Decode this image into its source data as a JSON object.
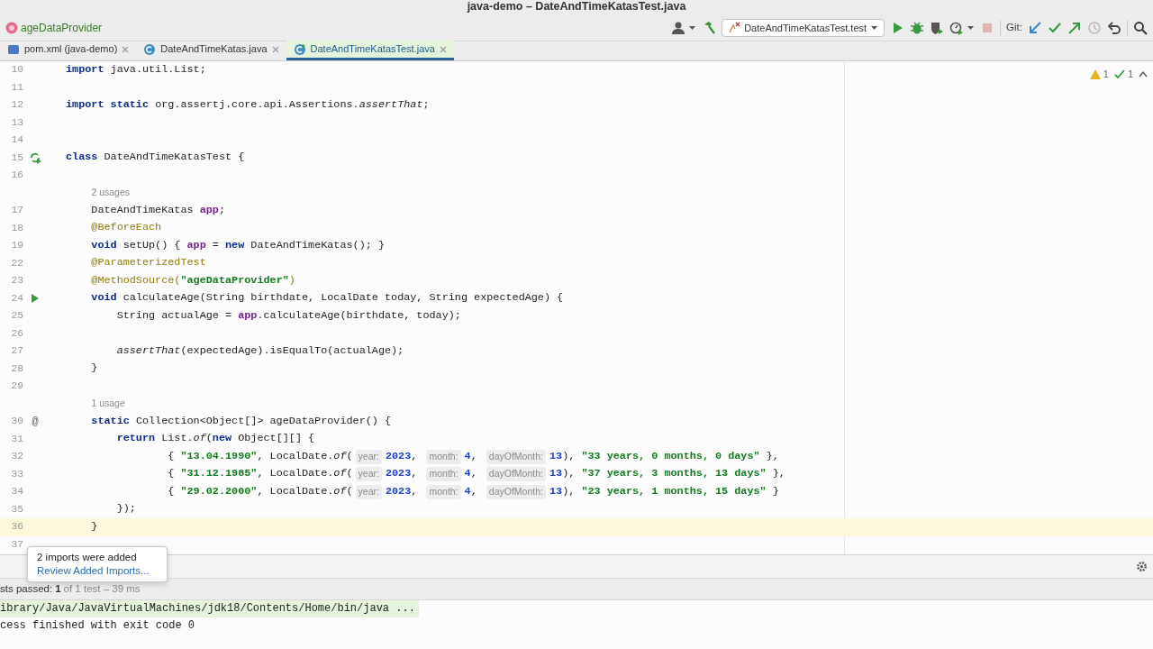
{
  "window": {
    "title": "java-demo – DateAndTimeKatasTest.java"
  },
  "breadcrumb": {
    "label": "ageDataProvider"
  },
  "toolbar": {
    "left_buttons": [
      {
        "kind": "user",
        "dropdown": true,
        "disabled": false
      },
      {
        "kind": "build",
        "dropdown": false,
        "disabled": false
      }
    ],
    "run_config": {
      "label": "DateAndTimeKatasTest.test"
    },
    "run_buttons": [
      {
        "kind": "run",
        "dropdown": false,
        "disabled": false
      },
      {
        "kind": "debug",
        "dropdown": false,
        "disabled": false
      },
      {
        "kind": "coverage",
        "dropdown": false,
        "disabled": false
      },
      {
        "kind": "profile",
        "dropdown": true,
        "disabled": false
      },
      {
        "kind": "stop",
        "dropdown": false,
        "disabled": true
      }
    ],
    "git": {
      "label": "Git:",
      "buttons": [
        {
          "kind": "update",
          "dropdown": false,
          "disabled": false
        },
        {
          "kind": "commit",
          "dropdown": false,
          "disabled": false
        },
        {
          "kind": "push",
          "dropdown": false,
          "disabled": false
        },
        {
          "kind": "history",
          "dropdown": false,
          "disabled": true
        },
        {
          "kind": "rollback",
          "dropdown": false,
          "disabled": false
        }
      ]
    },
    "right_buttons": [
      {
        "kind": "search",
        "dropdown": false,
        "disabled": false
      }
    ]
  },
  "tabs": [
    {
      "label": "pom.xml (java-demo)",
      "kind": "maven",
      "selected": false
    },
    {
      "label": "DateAndTimeKatas.java",
      "kind": "class",
      "selected": false
    },
    {
      "label": "DateAndTimeKatasTest.java",
      "kind": "test",
      "selected": true
    }
  ],
  "inspections": {
    "warnings": "1",
    "passed": "1"
  },
  "editor": {
    "lines": [
      {
        "number": "10",
        "current": false,
        "tokens": [
          {
            "kind": "kw",
            "text": "import "
          },
          {
            "kind": "plain",
            "text": "java.util.List;"
          }
        ]
      },
      {
        "number": "11",
        "current": false
      },
      {
        "number": "12",
        "current": false,
        "tokens": [
          {
            "kind": "kw",
            "text": "import static "
          },
          {
            "kind": "plain",
            "text": "org.assertj.core.api.Assertions."
          },
          {
            "kind": "italic",
            "text": "assertThat"
          },
          {
            "kind": "plain",
            "text": ";"
          }
        ]
      },
      {
        "number": "13",
        "current": false
      },
      {
        "number": "14",
        "current": false
      },
      {
        "number": "15",
        "current": false,
        "gutter": {
          "kind": "run-class"
        },
        "tokens": [
          {
            "kind": "kw",
            "text": "class "
          },
          {
            "kind": "plain",
            "text": "DateAndTimeKatasTest {"
          }
        ]
      },
      {
        "number": "16",
        "current": false
      },
      {
        "kind": "usage",
        "text": "    2 usages"
      },
      {
        "number": "17",
        "current": false,
        "tokens": [
          {
            "kind": "plain",
            "text": "    DateAndTimeKatas "
          },
          {
            "kind": "field",
            "text": "app"
          },
          {
            "kind": "plain",
            "text": ";"
          }
        ]
      },
      {
        "number": "18",
        "current": false,
        "tokens": [
          {
            "kind": "ann",
            "text": "    @BeforeEach"
          }
        ]
      },
      {
        "number": "19",
        "current": false,
        "tokens": [
          {
            "kind": "kw",
            "text": "    void "
          },
          {
            "kind": "plain",
            "text": "setUp() { "
          },
          {
            "kind": "field",
            "text": "app"
          },
          {
            "kind": "plain",
            "text": " = "
          },
          {
            "kind": "kw",
            "text": "new "
          },
          {
            "kind": "plain",
            "text": "DateAndTimeKatas(); }"
          }
        ]
      },
      {
        "number": "22",
        "current": false,
        "tokens": [
          {
            "kind": "ann",
            "text": "    @ParameterizedTest"
          }
        ]
      },
      {
        "number": "23",
        "current": false,
        "tokens": [
          {
            "kind": "ann",
            "text": "    @MethodSource("
          },
          {
            "kind": "str",
            "text": "\"ageDataProvider\""
          },
          {
            "kind": "ann",
            "text": ")"
          }
        ]
      },
      {
        "number": "24",
        "current": false,
        "gutter": {
          "kind": "run"
        },
        "tokens": [
          {
            "kind": "kw",
            "text": "    void "
          },
          {
            "kind": "plain",
            "text": "calculateAge(String birthdate, LocalDate today, String expectedAge) {"
          }
        ]
      },
      {
        "number": "25",
        "current": false,
        "tokens": [
          {
            "kind": "plain",
            "text": "        String actualAge = "
          },
          {
            "kind": "field",
            "text": "app"
          },
          {
            "kind": "plain",
            "text": ".calculateAge(birthdate, today);"
          }
        ]
      },
      {
        "number": "26",
        "current": false
      },
      {
        "number": "27",
        "current": false,
        "tokens": [
          {
            "kind": "italic",
            "text": "        assertThat"
          },
          {
            "kind": "plain",
            "text": "(expectedAge).isEqualTo(actualAge);"
          }
        ]
      },
      {
        "number": "28",
        "current": false,
        "tokens": [
          {
            "kind": "plain",
            "text": "    }"
          }
        ]
      },
      {
        "number": "29",
        "current": false
      },
      {
        "kind": "usage",
        "text": "    1 usage"
      },
      {
        "number": "30",
        "current": false,
        "gutter": {
          "kind": "symbol",
          "text": "@"
        },
        "tokens": [
          {
            "kind": "kw",
            "text": "    static "
          },
          {
            "kind": "plain",
            "text": "Collection<Object[]> ageDataProvider() {"
          }
        ]
      },
      {
        "number": "31",
        "current": false,
        "tokens": [
          {
            "kind": "kw",
            "text": "        return "
          },
          {
            "kind": "plain",
            "text": "List."
          },
          {
            "kind": "italic",
            "text": "of"
          },
          {
            "kind": "plain",
            "text": "("
          },
          {
            "kind": "kw",
            "text": "new "
          },
          {
            "kind": "plain",
            "text": "Object[][] {"
          }
        ]
      },
      {
        "number": "32",
        "current": false,
        "tokens": [
          {
            "kind": "plain",
            "text": "                { "
          },
          {
            "kind": "str",
            "text": "\"13.04.1990\""
          },
          {
            "kind": "plain",
            "text": ", LocalDate."
          },
          {
            "kind": "italic",
            "text": "of"
          },
          {
            "kind": "plain",
            "text": "("
          },
          {
            "kind": "hint",
            "text": "year:"
          },
          {
            "kind": "num",
            "text": "2023"
          },
          {
            "kind": "plain",
            "text": ", "
          },
          {
            "kind": "hint",
            "text": "month:"
          },
          {
            "kind": "num",
            "text": "4"
          },
          {
            "kind": "plain",
            "text": ", "
          },
          {
            "kind": "hint",
            "text": "dayOfMonth:"
          },
          {
            "kind": "num",
            "text": "13"
          },
          {
            "kind": "plain",
            "text": "), "
          },
          {
            "kind": "str",
            "text": "\"33 years, 0 months, 0 days\""
          },
          {
            "kind": "plain",
            "text": " },"
          }
        ]
      },
      {
        "number": "33",
        "current": false,
        "tokens": [
          {
            "kind": "plain",
            "text": "                { "
          },
          {
            "kind": "str",
            "text": "\"31.12.1985\""
          },
          {
            "kind": "plain",
            "text": ", LocalDate."
          },
          {
            "kind": "italic",
            "text": "of"
          },
          {
            "kind": "plain",
            "text": "("
          },
          {
            "kind": "hint",
            "text": "year:"
          },
          {
            "kind": "num",
            "text": "2023"
          },
          {
            "kind": "plain",
            "text": ", "
          },
          {
            "kind": "hint",
            "text": "month:"
          },
          {
            "kind": "num",
            "text": "4"
          },
          {
            "kind": "plain",
            "text": ", "
          },
          {
            "kind": "hint",
            "text": "dayOfMonth:"
          },
          {
            "kind": "num",
            "text": "13"
          },
          {
            "kind": "plain",
            "text": "), "
          },
          {
            "kind": "str",
            "text": "\"37 years, 3 months, 13 days\""
          },
          {
            "kind": "plain",
            "text": " },"
          }
        ]
      },
      {
        "number": "34",
        "current": false,
        "tokens": [
          {
            "kind": "plain",
            "text": "                { "
          },
          {
            "kind": "str",
            "text": "\"29.02.2000\""
          },
          {
            "kind": "plain",
            "text": ", LocalDate."
          },
          {
            "kind": "italic",
            "text": "of"
          },
          {
            "kind": "plain",
            "text": "("
          },
          {
            "kind": "hint",
            "text": "year:"
          },
          {
            "kind": "num",
            "text": "2023"
          },
          {
            "kind": "plain",
            "text": ", "
          },
          {
            "kind": "hint",
            "text": "month:"
          },
          {
            "kind": "num",
            "text": "4"
          },
          {
            "kind": "plain",
            "text": ", "
          },
          {
            "kind": "hint",
            "text": "dayOfMonth:"
          },
          {
            "kind": "num",
            "text": "13"
          },
          {
            "kind": "plain",
            "text": "), "
          },
          {
            "kind": "str",
            "text": "\"23 years, 1 months, 15 days\""
          },
          {
            "kind": "plain",
            "text": " }"
          }
        ]
      },
      {
        "number": "35",
        "current": false,
        "tokens": [
          {
            "kind": "plain",
            "text": "        });"
          }
        ]
      },
      {
        "number": "36",
        "current": true,
        "tokens": [
          {
            "kind": "plain",
            "text": "    }"
          }
        ]
      },
      {
        "number": "37",
        "current": false
      }
    ]
  },
  "popup": {
    "message": "2 imports were added",
    "link": "Review Added Imports..."
  },
  "run_panel": {
    "status_label": "sts passed:",
    "passed": "1",
    "detail": "of 1 test – 39 ms",
    "console": [
      {
        "text": "ibrary/Java/JavaVirtualMachines/jdk18/Contents/Home/bin/java ...",
        "highlighted": true
      },
      {
        "text": "cess finished with exit code 0",
        "highlighted": false
      }
    ]
  }
}
